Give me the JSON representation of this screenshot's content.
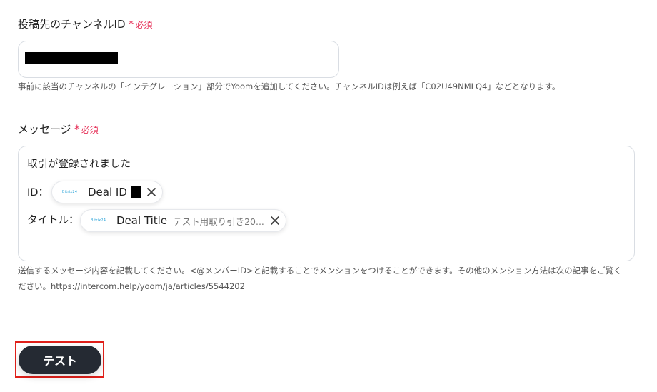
{
  "channel_field": {
    "label": "投稿先のチャンネルID",
    "required_star": "*",
    "required_text": "必須",
    "help": "事前に該当のチャンネルの「インテグレーション」部分でYoomを追加してください。チャンネルIDは例えば「C02U49NMLQ4」などとなります。"
  },
  "message_field": {
    "label": "メッセージ",
    "required_star": "*",
    "required_text": "必須",
    "lines": {
      "line1": "取引が登録されました",
      "id_prefix": "ID：",
      "title_prefix": "タイトル："
    },
    "chips": [
      {
        "logo": "Bitrix24",
        "label": "Deal ID",
        "preview": "",
        "icon": "bitrix24-logo"
      },
      {
        "logo": "Bitrix24",
        "label": "Deal Title",
        "preview": "テスト用取り引き20...",
        "icon": "bitrix24-logo"
      }
    ],
    "help_line1": "送信するメッセージ内容を記載してください。<@メンバーID>と記載することでメンションをつけることができます。その他のメンション方法は次の記事をご覧く",
    "help_line2": "ださい。https://intercom.help/yoom/ja/articles/5544202"
  },
  "actions": {
    "test_label": "テスト"
  },
  "colors": {
    "required": "#e6335a",
    "button_bg": "#252a33",
    "highlight": "#e0201a",
    "border": "#d9dde3"
  }
}
